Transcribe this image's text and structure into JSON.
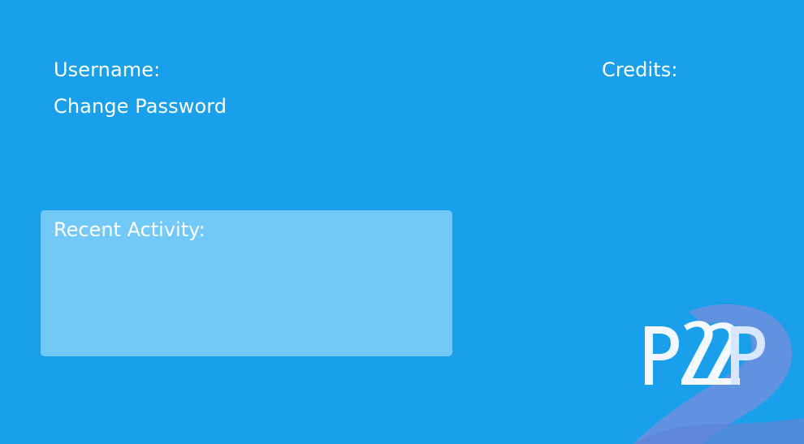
{
  "account": {
    "username_label": "Username:",
    "change_password_label": "Change Password",
    "credits_label": "Credits:"
  },
  "recent_activity": {
    "title": "Recent Activity:"
  },
  "brand": {
    "logo_text": "P2P",
    "background_color": "#1aa0ea",
    "panel_color": "#72c9f7"
  }
}
